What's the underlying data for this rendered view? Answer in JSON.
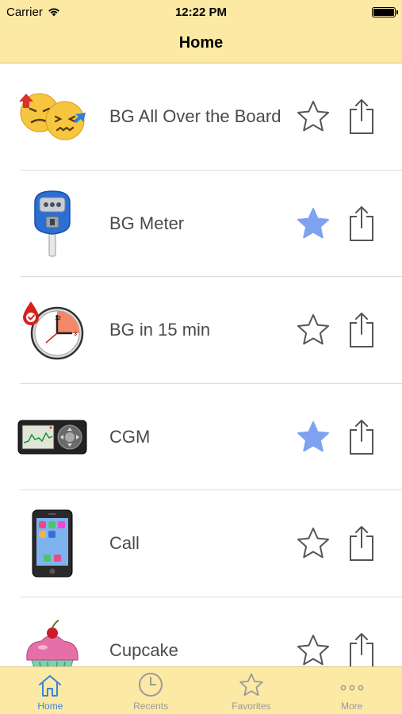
{
  "status_bar": {
    "carrier": "Carrier",
    "time": "12:22 PM"
  },
  "nav": {
    "title": "Home"
  },
  "colors": {
    "bar_background": "#fbe9a4",
    "star_favorite": "#7fa2f0",
    "tab_active": "#3b82e0",
    "tab_inactive": "#9a9a9a"
  },
  "items": [
    {
      "label": "BG All Over the Board",
      "icon": "confused-faces-icon",
      "favorite": false
    },
    {
      "label": "BG Meter",
      "icon": "parking-meter-icon",
      "favorite": true
    },
    {
      "label": "BG in 15 min",
      "icon": "clock-blood-drop-icon",
      "favorite": false
    },
    {
      "label": "CGM",
      "icon": "cgm-device-icon",
      "favorite": true
    },
    {
      "label": "Call",
      "icon": "smartphone-icon",
      "favorite": false
    },
    {
      "label": "Cupcake",
      "icon": "cupcake-icon",
      "favorite": false
    }
  ],
  "tabs": [
    {
      "label": "Home",
      "icon": "house-icon",
      "active": true
    },
    {
      "label": "Recents",
      "icon": "clock-icon",
      "active": false
    },
    {
      "label": "Favorites",
      "icon": "star-icon",
      "active": false
    },
    {
      "label": "More",
      "icon": "more-dots-icon",
      "active": false
    }
  ]
}
